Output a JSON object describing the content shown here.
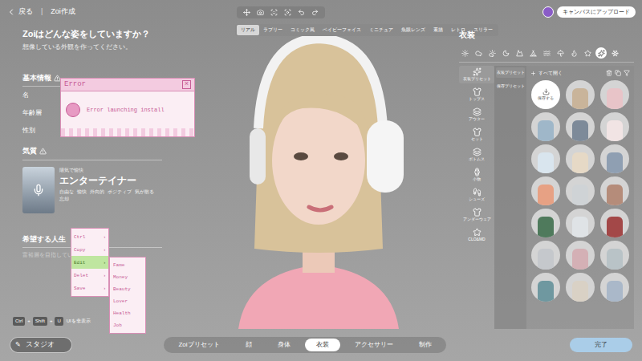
{
  "topbar": {
    "back": "戻る",
    "separator": "|",
    "title": "Zoi作成",
    "upload": "キャンバスにアップロード"
  },
  "style_tabs": [
    {
      "label": "リアル",
      "selected": true
    },
    {
      "label": "ラブリー",
      "selected": false
    },
    {
      "label": "コミック風",
      "selected": false
    },
    {
      "label": "ベイビーフェイス",
      "selected": false
    },
    {
      "label": "ミニチュア",
      "selected": false
    },
    {
      "label": "魚眼レンズ",
      "selected": false
    },
    {
      "label": "素描",
      "selected": false
    },
    {
      "label": "レトロ",
      "selected": false
    },
    {
      "label": "スリラー",
      "selected": false
    }
  ],
  "left": {
    "heading": "Zoiはどんな姿をしていますか？",
    "subheading": "想像している外観を作ってください。",
    "basic_info": {
      "title": "基本情報",
      "fields": [
        "名",
        "年齢層",
        "性別"
      ]
    },
    "temperament": {
      "title": "気質",
      "card": {
        "subtitle": "陽気で愉快",
        "name": "エンターテイナー",
        "traits": [
          "自由な",
          "愉快",
          "外向的",
          "ポジティブ",
          "気が散る",
          "忘却"
        ]
      }
    },
    "life": {
      "title": "希望する人生",
      "placeholder": "富裕層を目指しています"
    },
    "shortcut": {
      "keys": [
        "Ctrl",
        "+",
        "Shift",
        "+",
        "U"
      ],
      "label": "UIを非表示"
    },
    "studio_button": "スタジオ"
  },
  "error_dialog": {
    "title": "Error",
    "close": "×",
    "message": "Error launching install"
  },
  "context_menu": {
    "arrow": "›",
    "items": [
      {
        "label": "Ctrl",
        "selected": false
      },
      {
        "label": "Copy",
        "selected": false
      },
      {
        "label": "Edit",
        "selected": true
      },
      {
        "label": "Delet",
        "selected": false
      },
      {
        "label": "Save",
        "selected": false
      }
    ]
  },
  "submenu": {
    "items": [
      "Fame",
      "Money",
      "Beauty",
      "Lover",
      "Health",
      "Job"
    ]
  },
  "outfit_panel": {
    "title": "衣装",
    "filters": [
      {
        "selected": false
      },
      {
        "selected": false
      },
      {
        "selected": false
      },
      {
        "selected": false
      },
      {
        "selected": false
      },
      {
        "selected": false
      },
      {
        "selected": false
      },
      {
        "selected": false
      },
      {
        "selected": false
      },
      {
        "selected": false
      },
      {
        "selected": true
      },
      {
        "selected": false
      }
    ],
    "categories": [
      {
        "label": "衣装プリセット",
        "selected": true
      },
      {
        "label": "トップス",
        "selected": false
      },
      {
        "label": "アウター",
        "selected": false
      },
      {
        "label": "セット",
        "selected": false
      },
      {
        "label": "ボトムス",
        "selected": false
      },
      {
        "label": "小物",
        "selected": false
      },
      {
        "label": "シューズ",
        "selected": false
      },
      {
        "label": "アンダーウェア",
        "selected": false
      },
      {
        "label": "CLO&MD",
        "selected": false
      }
    ],
    "subtabs": [
      {
        "label": "衣装プリセット",
        "selected": true
      },
      {
        "label": "保存プリセット",
        "selected": false
      }
    ],
    "expand_all": "すべて開く",
    "save_label": "保存する",
    "outfits": [
      {
        "color": "#c9b49a"
      },
      {
        "color": "#e8c4c8"
      },
      {
        "color": "#9fb7c9"
      },
      {
        "color": "#7d8a99"
      },
      {
        "color": "#f1e4e4"
      },
      {
        "color": "#d9e5ee"
      },
      {
        "color": "#e6d9c6"
      },
      {
        "color": "#8f9fb2"
      },
      {
        "color": "#e7a184"
      },
      {
        "color": "#cfd3d6"
      },
      {
        "color": "#b58c7a"
      },
      {
        "color": "#4f7a5c"
      },
      {
        "color": "#dfe3e6"
      },
      {
        "color": "#a34848"
      },
      {
        "color": "#c5c8cc"
      },
      {
        "color": "#d4b0b5"
      },
      {
        "color": "#b9c3c7"
      },
      {
        "color": "#6f98a0"
      },
      {
        "color": "#d9d1c5"
      },
      {
        "color": "#aab8c9"
      }
    ]
  },
  "bottom_tabs": [
    {
      "label": "Zoiプリセット",
      "selected": false
    },
    {
      "label": "顔",
      "selected": false
    },
    {
      "label": "身体",
      "selected": false
    },
    {
      "label": "衣装",
      "selected": true
    },
    {
      "label": "アクセサリー",
      "selected": false
    },
    {
      "label": "制作",
      "selected": false
    }
  ],
  "done_button": "完了"
}
